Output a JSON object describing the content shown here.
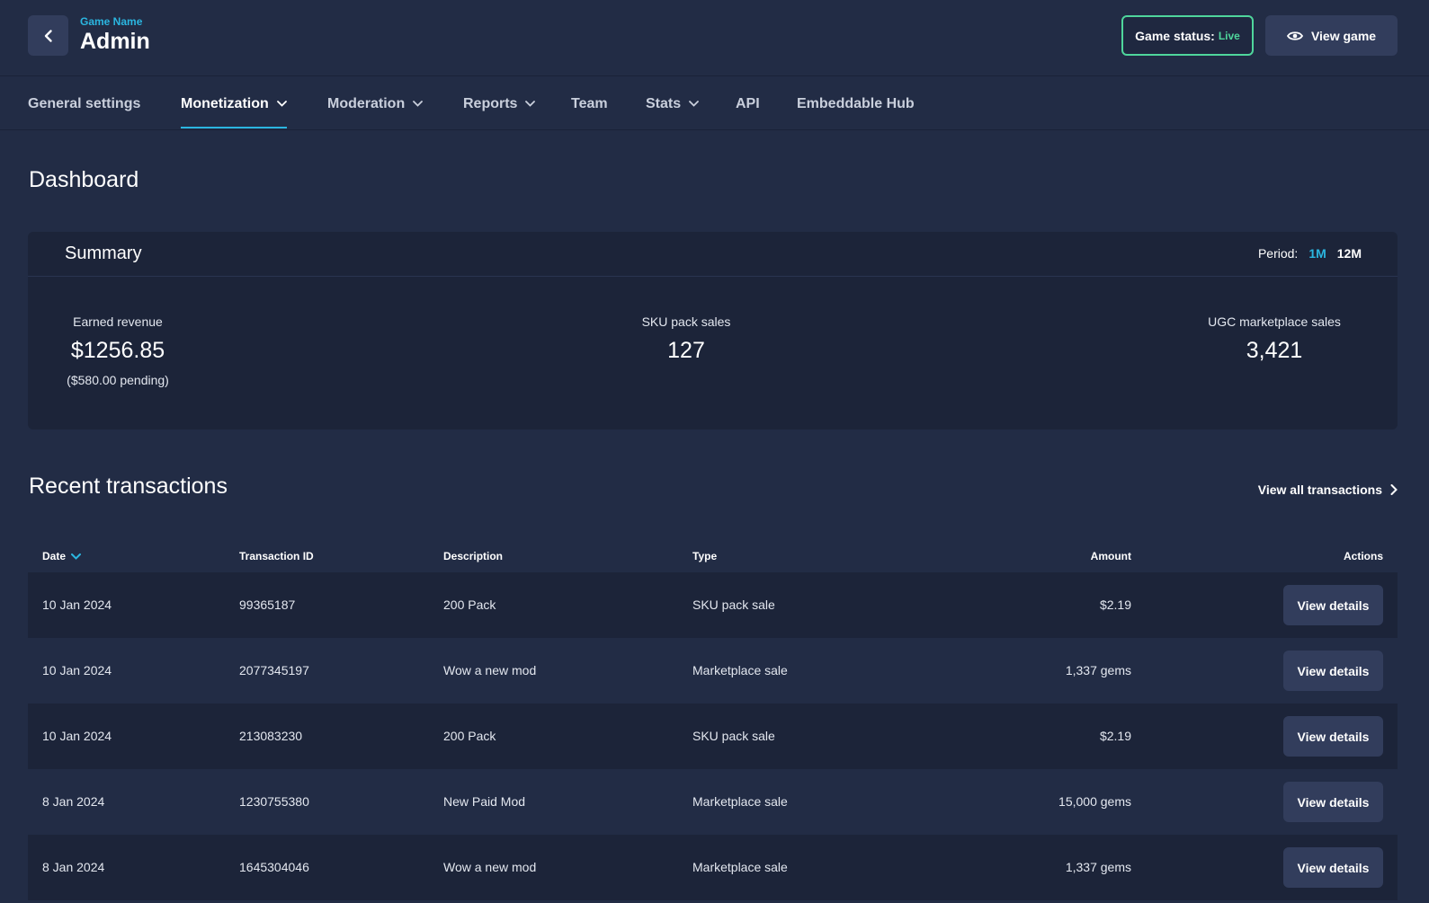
{
  "header": {
    "game_name": "Game Name",
    "title": "Admin",
    "status_label": "Game status:",
    "status_value": "Live",
    "view_game_label": "View game"
  },
  "nav": {
    "items": [
      {
        "label": "General settings",
        "has_dropdown": false,
        "active": false
      },
      {
        "label": "Monetization",
        "has_dropdown": true,
        "active": true
      },
      {
        "label": "Moderation",
        "has_dropdown": true,
        "active": false
      },
      {
        "label": "Reports",
        "has_dropdown": true,
        "active": false
      },
      {
        "label": "Team",
        "has_dropdown": false,
        "active": false
      },
      {
        "label": "Stats",
        "has_dropdown": true,
        "active": false
      },
      {
        "label": "API",
        "has_dropdown": false,
        "active": false
      },
      {
        "label": "Embeddable Hub",
        "has_dropdown": false,
        "active": false
      }
    ]
  },
  "dashboard": {
    "title": "Dashboard"
  },
  "summary": {
    "title": "Summary",
    "period_label": "Period:",
    "period_options": [
      "1M",
      "12M"
    ],
    "period_selected": "1M",
    "earned_revenue_label": "Earned revenue",
    "earned_revenue_value": "$1256.85",
    "earned_revenue_pending": "($580.00 pending)",
    "sku_label": "SKU pack sales",
    "sku_value": "127",
    "ugc_label": "UGC marketplace sales",
    "ugc_value": "3,421"
  },
  "transactions": {
    "title": "Recent transactions",
    "view_all_label": "View all transactions",
    "columns": {
      "date": "Date",
      "id": "Transaction ID",
      "description": "Description",
      "type": "Type",
      "amount": "Amount",
      "actions": "Actions"
    },
    "action_label": "View details",
    "rows": [
      {
        "date": "10 Jan 2024",
        "id": "99365187",
        "description": "200 Pack",
        "type": "SKU pack sale",
        "amount": "$2.19"
      },
      {
        "date": "10 Jan 2024",
        "id": "2077345197",
        "description": "Wow a new mod",
        "type": "Marketplace sale",
        "amount": "1,337 gems"
      },
      {
        "date": "10 Jan 2024",
        "id": "213083230",
        "description": "200 Pack",
        "type": "SKU pack sale",
        "amount": "$2.19"
      },
      {
        "date": "8 Jan 2024",
        "id": "1230755380",
        "description": "New Paid Mod",
        "type": "Marketplace sale",
        "amount": "15,000 gems"
      },
      {
        "date": "8 Jan 2024",
        "id": "1645304046",
        "description": "Wow a new mod",
        "type": "Marketplace sale",
        "amount": "1,337 gems"
      }
    ]
  },
  "colors": {
    "background": "#222c45",
    "card": "#1c2439",
    "accent": "#2bb6e0",
    "live": "#4fd69c",
    "button": "#323d5c"
  },
  "icons": {
    "back": "chevron-left-icon",
    "view_game": "eye-icon",
    "dropdown": "chevron-down-icon",
    "view_all": "chevron-right-icon",
    "sort": "sort-down-icon"
  }
}
